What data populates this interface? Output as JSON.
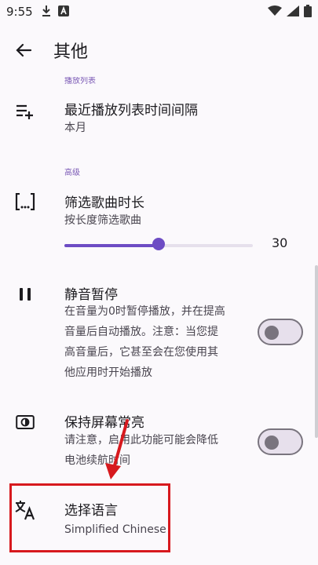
{
  "status_bar": {
    "time": "9:55",
    "icons_left": [
      "download-icon",
      "notification-a-icon"
    ],
    "icons_right": [
      "wifi-icon",
      "signal-icon",
      "battery-icon"
    ]
  },
  "app_bar": {
    "title": "其他"
  },
  "sections": {
    "playlist_header": "播放列表",
    "advanced_header": "高级"
  },
  "items": {
    "recent_playlist": {
      "title": "最近播放列表时间间隔",
      "subtitle": "本月"
    },
    "filter_duration": {
      "title": "筛选歌曲时长",
      "subtitle": "按长度筛选歌曲",
      "value": "30",
      "fraction": 0.5
    },
    "mute_pause": {
      "title": "静音暂停",
      "subtitle_lines": [
        "在音量为0时暂停播放，并在提高",
        "音量后自动播放。注意：当您提",
        "高音量后，它甚至会在您使用其",
        "他应用时开始播放"
      ],
      "enabled": false
    },
    "keep_screen_on": {
      "title": "保持屏幕常亮",
      "subtitle_lines": [
        "请注意，启用此功能可能会降低",
        "电池续航时间"
      ],
      "enabled": false
    },
    "language": {
      "title": "选择语言",
      "subtitle": "Simplified Chinese"
    }
  },
  "colors": {
    "accent": "#6d4cc4",
    "highlight": "#d7191e",
    "background": "#fbf9fc"
  }
}
